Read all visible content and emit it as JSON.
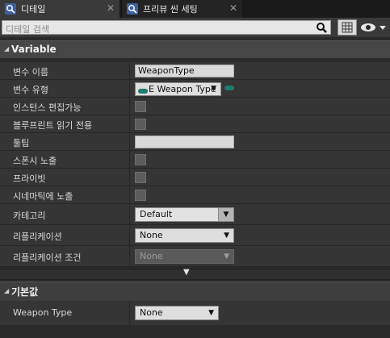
{
  "tabs": [
    {
      "label": "디테일",
      "icon": "details-magnifier-icon",
      "active": true
    },
    {
      "label": "프리뷰 씬 세팅",
      "icon": "preview-magnifier-icon",
      "active": false
    }
  ],
  "search": {
    "placeholder": "디테일 검색"
  },
  "category": {
    "label": "Variable"
  },
  "properties": {
    "var_name": {
      "label": "변수 이름",
      "value": "WeaponType"
    },
    "var_type": {
      "label": "변수 유형",
      "value": "E Weapon Type"
    },
    "instance_editable": {
      "label": "인스턴스 편집가능"
    },
    "blueprint_readonly": {
      "label": "블루프린트 읽기 전용"
    },
    "tooltip": {
      "label": "툴팁",
      "value": ""
    },
    "expose_spawn": {
      "label": "스폰시 노출"
    },
    "private": {
      "label": "프라이빗"
    },
    "expose_cinematics": {
      "label": "시네마틱에 노출"
    },
    "category_field": {
      "label": "카테고리",
      "value": "Default"
    },
    "replication": {
      "label": "리플리케이션",
      "value": "None"
    },
    "replication_condition": {
      "label": "리플리케이션 조건",
      "value": "None"
    }
  },
  "default_section": {
    "label": "기본값",
    "weapon_type": {
      "label": "Weapon Type",
      "value": "None"
    }
  },
  "colors": {
    "pin": "#1f7a6f",
    "bg": "#2a2a2a",
    "row": "#353535"
  }
}
